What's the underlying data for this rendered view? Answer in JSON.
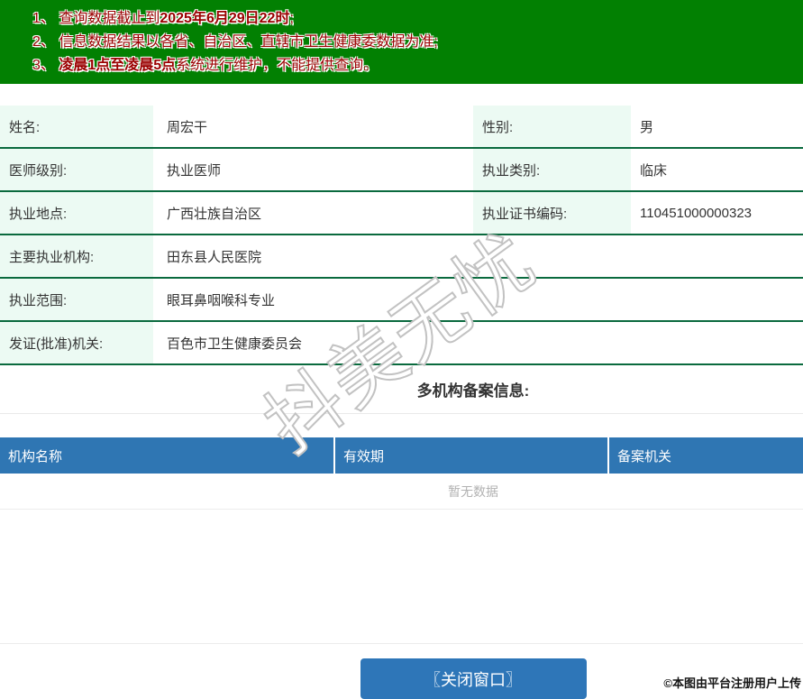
{
  "colors": {
    "banner_bg": "#028002",
    "banner_text": "#9a0000",
    "label_bg": "#ecfaf3",
    "row_border": "#0a6a3e",
    "table_header_bg": "#2f76b3",
    "button_bg": "#2e76b8",
    "empty_text": "#b2b2b2"
  },
  "banner": {
    "line1_pre": "1、 查询数据截止到",
    "line1_bold": "2025年6月29日22时",
    "line1_post": ";",
    "line2": "2、 信息数据结果以各省、自治区、直辖市卫生健康委数据为准;",
    "line3_pre": "3、 ",
    "line3_bold": "凌晨1点至凌晨5点",
    "line3_post": "系统进行维护，不能提供查询。"
  },
  "info": {
    "rows_paired": [
      {
        "label1": "姓名:",
        "value1": "周宏干",
        "label2": "性别:",
        "value2": "男"
      },
      {
        "label1": "医师级别:",
        "value1": "执业医师",
        "label2": "执业类别:",
        "value2": "临床"
      },
      {
        "label1": "执业地点:",
        "value1": "广西壮族自治区",
        "label2": "执业证书编码:",
        "value2": "110451000000323"
      }
    ],
    "rows_full": [
      {
        "label": "主要执业机构:",
        "value": "田东县人民医院"
      },
      {
        "label": "执业范围:",
        "value": "眼耳鼻咽喉科专业"
      },
      {
        "label": "发证(批准)机关:",
        "value": "百色市卫生健康委员会"
      }
    ]
  },
  "backup_section": {
    "title": "多机构备案信息:",
    "headers": [
      "机构名称",
      "有效期",
      "备案机关"
    ],
    "empty_text": "暂无数据"
  },
  "footer": {
    "close_button_label": "〖关闭窗口〗",
    "copyright": "©本图由平台注册用户上传"
  },
  "watermark": {
    "text": "抖美无忧"
  }
}
